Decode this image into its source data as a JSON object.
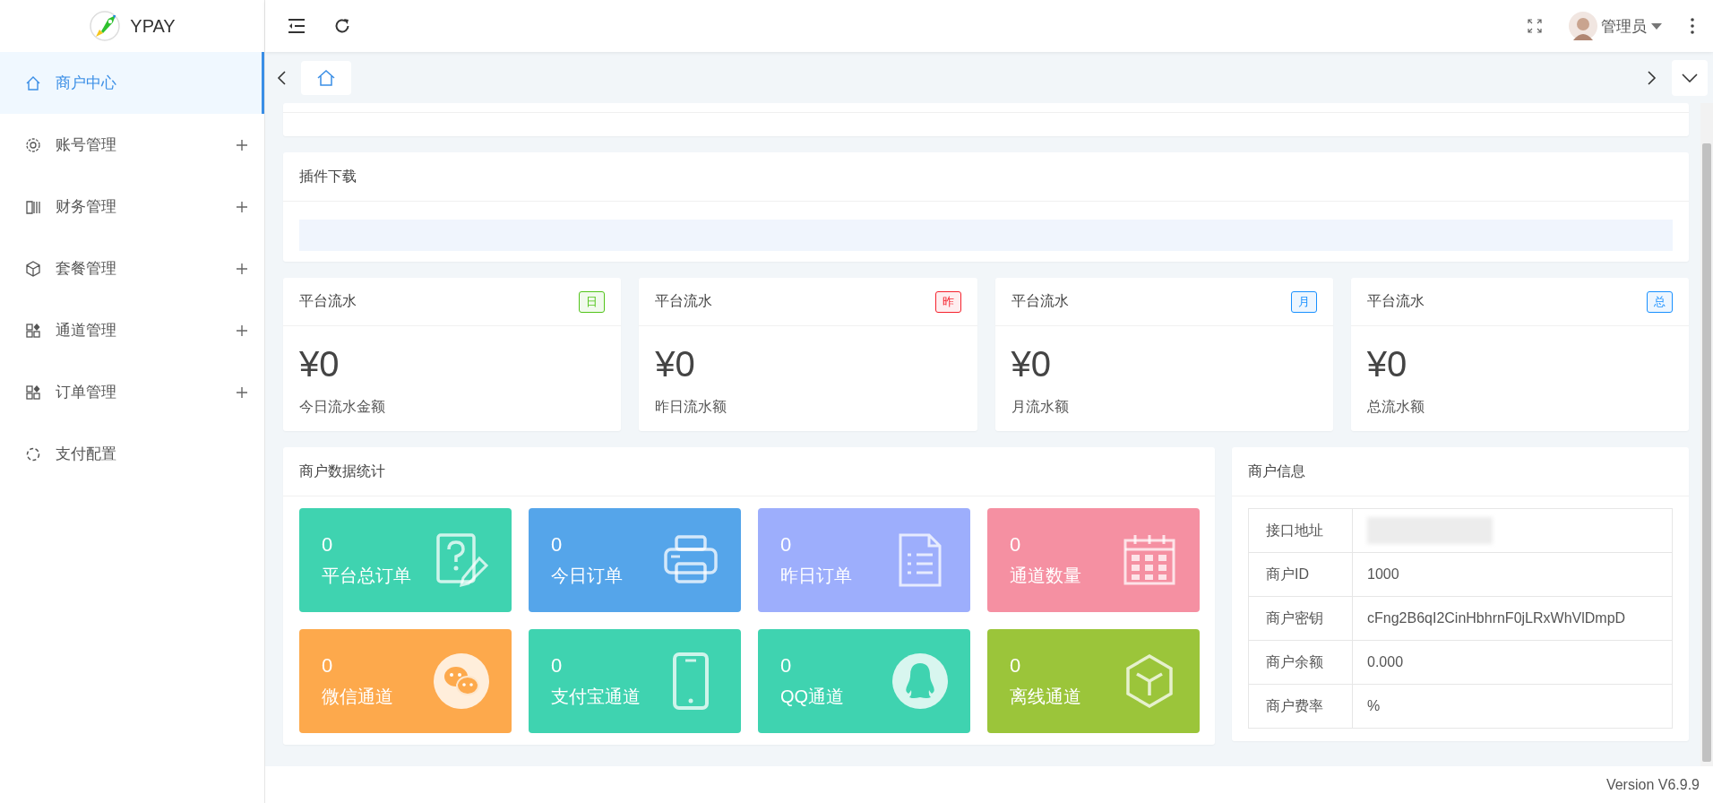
{
  "sidebar": {
    "logo": {
      "text": "YPAY"
    },
    "items": [
      {
        "label": "商户中心",
        "selected": true,
        "expandable": false
      },
      {
        "label": "账号管理",
        "selected": false,
        "expandable": true
      },
      {
        "label": "财务管理",
        "selected": false,
        "expandable": true
      },
      {
        "label": "套餐管理",
        "selected": false,
        "expandable": true
      },
      {
        "label": "通道管理",
        "selected": false,
        "expandable": true
      },
      {
        "label": "订单管理",
        "selected": false,
        "expandable": true
      },
      {
        "label": "支付配置",
        "selected": false,
        "expandable": false
      }
    ]
  },
  "header": {
    "user": {
      "name": "管理员"
    }
  },
  "tabs": [
    {
      "kind": "home",
      "selected": true
    }
  ],
  "plugin_card": {
    "title": "插件下载"
  },
  "stat_cards": [
    {
      "title": "平台流水",
      "badge": "日",
      "color": "#52c41a",
      "amount": "¥0",
      "caption": "今日流水金额"
    },
    {
      "title": "平台流水",
      "badge": "昨",
      "color": "#f5222d",
      "amount": "¥0",
      "caption": "昨日流水额"
    },
    {
      "title": "平台流水",
      "badge": "月",
      "color": "#1890ff",
      "amount": "¥0",
      "caption": "月流水额"
    },
    {
      "title": "平台流水",
      "badge": "总",
      "color": "#1890ff",
      "amount": "¥0",
      "caption": "总流水额"
    }
  ],
  "merchant_stats": {
    "title": "商户数据统计",
    "tiles": [
      {
        "value": "0",
        "label": "平台总订单",
        "color": "#3fd3b0"
      },
      {
        "value": "0",
        "label": "今日订单",
        "color": "#55a5ea"
      },
      {
        "value": "0",
        "label": "昨日订单",
        "color": "#9daefc"
      },
      {
        "value": "0",
        "label": "通道数量",
        "color": "#f590a2"
      },
      {
        "value": "0",
        "label": "微信通道",
        "color": "#fda94c"
      },
      {
        "value": "0",
        "label": "支付宝通道",
        "color": "#3fd3b0"
      },
      {
        "value": "0",
        "label": "QQ通道",
        "color": "#3fd3b0"
      },
      {
        "value": "0",
        "label": "离线通道",
        "color": "#9bc53a"
      }
    ]
  },
  "merchant_info": {
    "title": "商户信息",
    "rows": [
      {
        "label": "接口地址",
        "kind": "blurred"
      },
      {
        "label": "商户ID",
        "kind": "text",
        "value": "1000"
      },
      {
        "label": "商户密钥",
        "kind": "text",
        "value": "cFng2B6qI2CinHbhrnF0jLRxWhVlDmpD"
      },
      {
        "label": "商户余额",
        "kind": "text",
        "value": "0.000"
      },
      {
        "label": "商户费率",
        "kind": "text",
        "value": "%"
      }
    ]
  },
  "footer": {
    "version": "Version V6.9.9"
  }
}
